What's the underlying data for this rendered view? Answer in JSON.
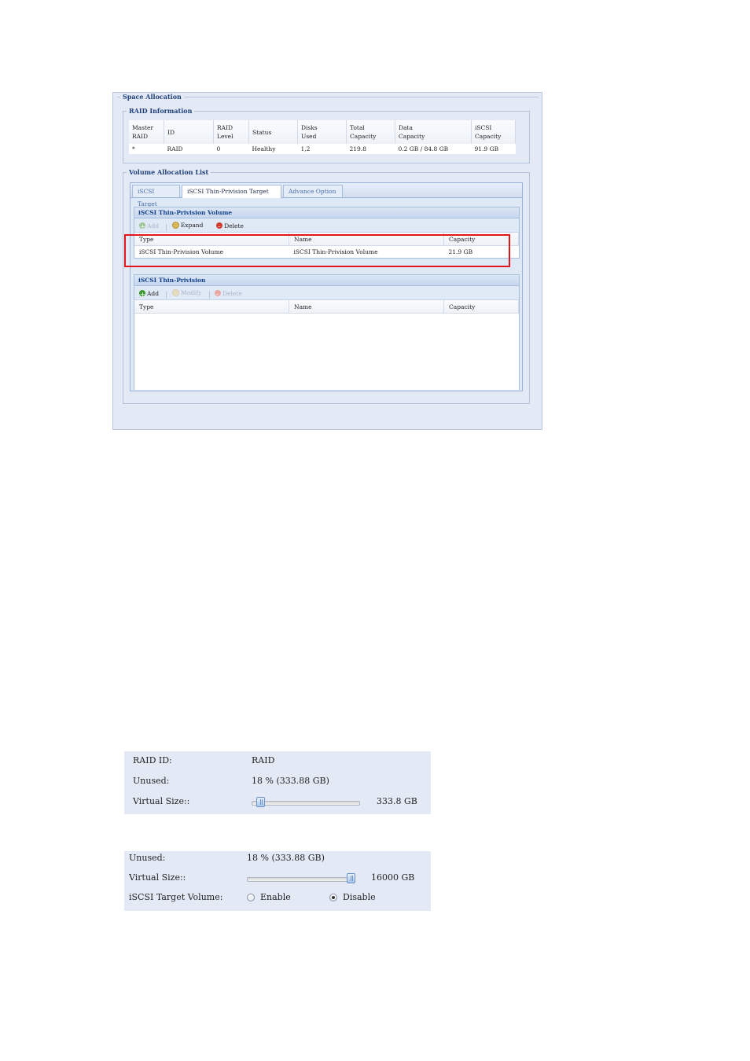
{
  "space_allocation": {
    "title": "Space Allocation",
    "raid_info": {
      "title": "RAID Information",
      "columns": [
        "Master\nRAID",
        "ID",
        "RAID\nLevel",
        "Status",
        "Disks\nUsed",
        "Total\nCapacity",
        "Data\nCapacity",
        "iSCSI\nCapacity"
      ],
      "row": [
        "*",
        "RAID",
        "0",
        "Healthy",
        "1,2",
        "219.8",
        "0.2 GB / 84.8 GB",
        "91.9 GB"
      ]
    },
    "volume_list": {
      "title": "Volume Allocation List",
      "tabs": [
        "iSCSI Target",
        "iSCSI Thin-Privision Target",
        "Advance Option"
      ],
      "active_tab": 1,
      "thin_volume": {
        "title": "iSCSI Thin-Privision Volume",
        "toolbar": {
          "add": "Add",
          "expand": "Expand",
          "delete": "Delete"
        },
        "columns": [
          "Type",
          "Name",
          "Capacity"
        ],
        "rows": [
          [
            "iSCSI Thin-Privision Volume",
            "iSCSI Thin-Privision Volume",
            "21.9 GB"
          ]
        ]
      },
      "thin_target": {
        "title": "iSCSI Thin-Privision",
        "toolbar": {
          "add": "Add",
          "modify": "Modify",
          "delete": "Delete"
        },
        "columns": [
          "Type",
          "Name",
          "Capacity"
        ]
      }
    }
  },
  "form1": {
    "raid_id_label": "RAID ID:",
    "raid_id_value": "RAID",
    "unused_label": "Unused:",
    "unused_value": "18 % (333.88 GB)",
    "virtual_size_label": "Virtual Size::",
    "virtual_size_value": "333.8 GB",
    "slider_fraction": 0.05
  },
  "form2": {
    "unused_label": "Unused:",
    "unused_value": "18 % (333.88 GB)",
    "virtual_size_label": "Virtual Size::",
    "virtual_size_value": "16000 GB",
    "slider_fraction": 1.0,
    "target_volume_label": "iSCSI Target Volume:",
    "enable_label": "Enable",
    "disable_label": "Disable",
    "selected": "Disable"
  }
}
